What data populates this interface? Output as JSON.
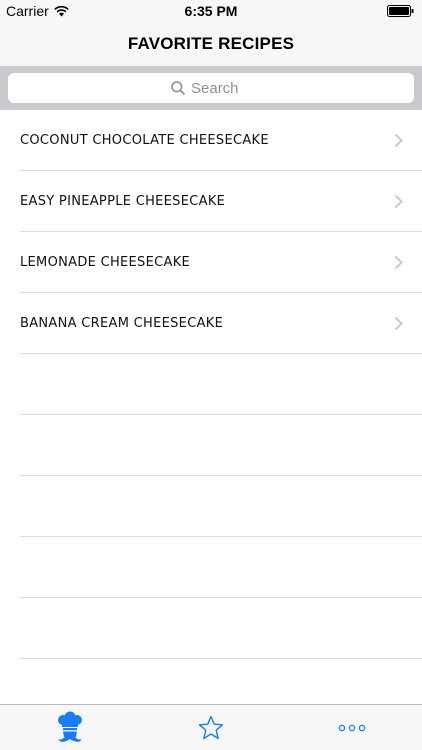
{
  "status_bar": {
    "carrier": "Carrier",
    "time": "6:35 PM"
  },
  "nav": {
    "title": "FAVORITE RECIPES"
  },
  "search": {
    "placeholder": "Search"
  },
  "recipes": [
    {
      "title": "COCONUT CHOCOLATE CHEESECAKE"
    },
    {
      "title": "EASY PINEAPPLE CHEESECAKE"
    },
    {
      "title": "LEMONADE CHEESECAKE"
    },
    {
      "title": "BANANA CREAM CHEESECAKE"
    }
  ],
  "tabs": [
    {
      "icon": "chef-icon",
      "selected": true
    },
    {
      "icon": "star-icon",
      "selected": false
    },
    {
      "icon": "more-icon",
      "selected": false
    }
  ],
  "colors": {
    "accent": "#1a7cf2",
    "separator": "#dcdcdc",
    "search_bg": "#c9c9ce"
  }
}
